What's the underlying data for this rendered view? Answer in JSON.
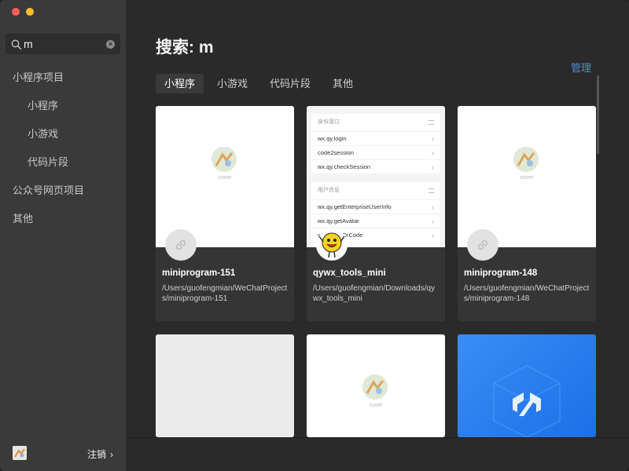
{
  "window": {
    "title_dots": [
      "close",
      "minimize"
    ]
  },
  "search": {
    "value": "m",
    "icon": "magnifier-icon",
    "clear_icon": "clear-icon"
  },
  "sidebar": {
    "items": [
      {
        "label": "小程序项目",
        "level": 0
      },
      {
        "label": "小程序",
        "level": 1
      },
      {
        "label": "小游戏",
        "level": 1
      },
      {
        "label": "代码片段",
        "level": 1
      },
      {
        "label": "公众号网页项目",
        "level": 0
      },
      {
        "label": "其他",
        "level": 0
      }
    ],
    "footer": {
      "logout_label": "注销",
      "chevron": "›"
    }
  },
  "main": {
    "title": "搜索: m",
    "manage_label": "管理",
    "tabs": [
      {
        "label": "小程序",
        "active": true
      },
      {
        "label": "小游戏",
        "active": false
      },
      {
        "label": "代码片段",
        "active": false
      },
      {
        "label": "其他",
        "active": false
      }
    ],
    "cards": [
      {
        "name": "miniprogram-151",
        "path": "/Users/guofengmian/WeChatProjects/miniprogram-151",
        "thumb": "cover",
        "cover_label": "cover"
      },
      {
        "name": "qywx_tools_mini",
        "path": "/Users/guofengmian/Downloads/qywx_tools_mini",
        "thumb": "api-list",
        "api_groups": [
          {
            "header": "身份接口",
            "rows": [
              "wx.qy.login",
              "code2session",
              "wx.qy.checkSession"
            ]
          },
          {
            "header": "用户信息",
            "rows": [
              "wx.qy.getEnterpriseUserInfo",
              "wx.qy.getAvatar",
              "wx.qy.getQrCode"
            ]
          }
        ]
      },
      {
        "name": "miniprogram-148",
        "path": "/Users/guofengmian/WeChatProjects/miniprogram-148",
        "thumb": "cover",
        "cover_label": "cover"
      },
      {
        "name": "",
        "path": "",
        "thumb": "blank"
      },
      {
        "name": "",
        "path": "",
        "thumb": "cover",
        "cover_label": "cover"
      },
      {
        "name": "",
        "path": "",
        "thumb": "blue-logo"
      }
    ]
  },
  "colors": {
    "accent": "#4c8fd6",
    "sidebar_bg": "#3a3a3a",
    "main_bg": "#2a2a2a",
    "card_bg": "#353535"
  }
}
